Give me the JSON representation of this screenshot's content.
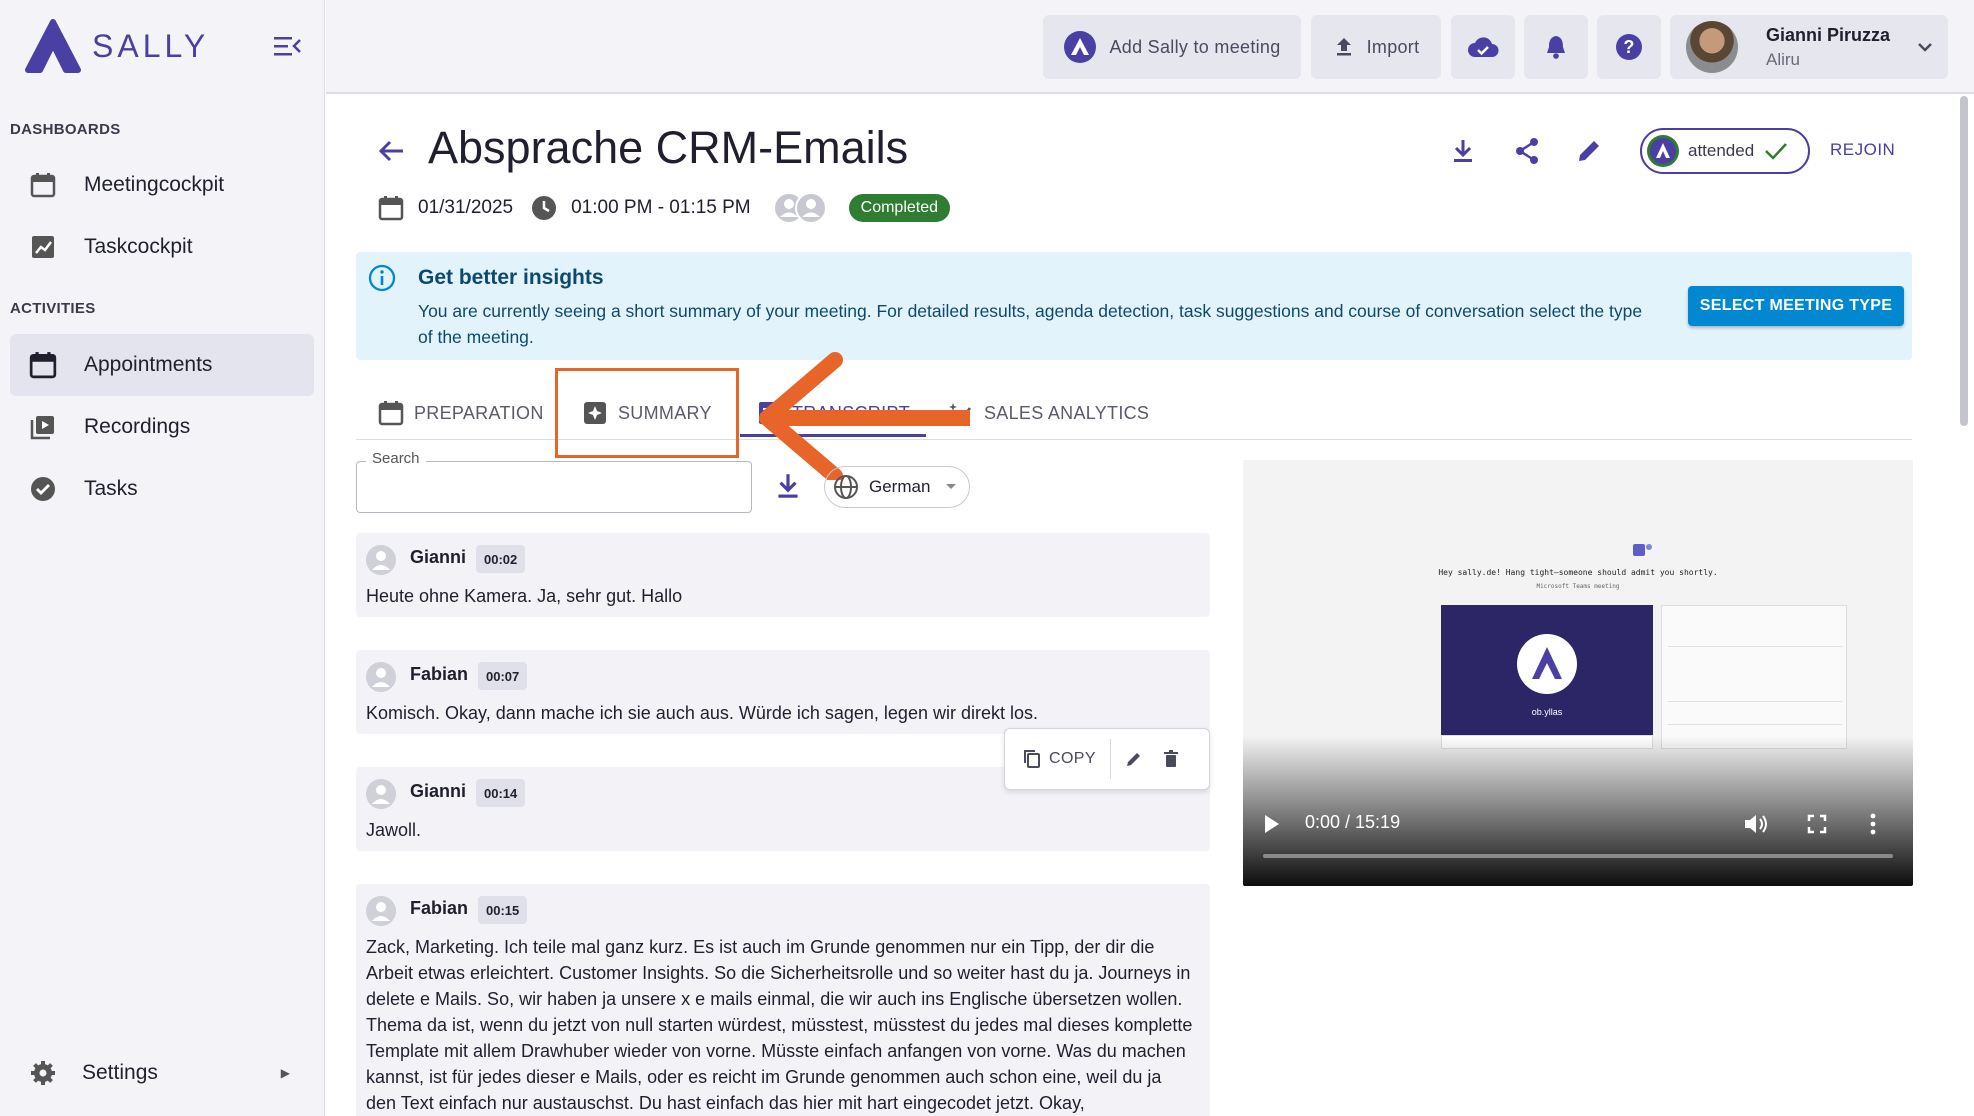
{
  "app": {
    "name": "SALLY"
  },
  "sidebar": {
    "sections": [
      {
        "label": "DASHBOARDS"
      },
      {
        "label": "ACTIVITIES"
      }
    ],
    "items": [
      {
        "label": "Meetingcockpit"
      },
      {
        "label": "Taskcockpit"
      },
      {
        "label": "Appointments"
      },
      {
        "label": "Recordings"
      },
      {
        "label": "Tasks"
      }
    ],
    "settings_label": "Settings"
  },
  "topbar": {
    "add_sally_label": "Add Sally to meeting",
    "import_label": "Import",
    "user": {
      "name": "Gianni Piruzza",
      "org": "Aliru"
    }
  },
  "meeting": {
    "title": "Absprache CRM-Emails",
    "date": "01/31/2025",
    "time": "01:00 PM - 01:15 PM",
    "status": "Completed",
    "attendance": "attended",
    "rejoin_label": "REJOIN"
  },
  "info": {
    "title": "Get better insights",
    "text": "You are currently seeing a short summary of your meeting. For detailed results, agenda detection, task suggestions and course of conversation select the type of the meeting.",
    "button": "SELECT MEETING TYPE"
  },
  "tabs": [
    {
      "label": "PREPARATION"
    },
    {
      "label": "SUMMARY"
    },
    {
      "label": "TRANSCRIPT"
    },
    {
      "label": "SALES ANALYTICS"
    }
  ],
  "transcript": {
    "search_label": "Search",
    "search_value": "",
    "language": "German",
    "copy_label": "COPY",
    "utterances": [
      {
        "speaker": "Gianni",
        "time": "00:02",
        "text": "Heute ohne Kamera. Ja, sehr gut. Hallo"
      },
      {
        "speaker": "Fabian",
        "time": "00:07",
        "text": "Komisch. Okay, dann mache ich sie auch aus. Würde ich sagen, legen wir direkt los."
      },
      {
        "speaker": "Gianni",
        "time": "00:14",
        "text": "Jawoll."
      },
      {
        "speaker": "Fabian",
        "time": "00:15",
        "text": "Zack, Marketing. Ich teile mal ganz kurz. Es ist auch im Grunde genommen nur ein Tipp, der dir die Arbeit etwas erleichtert. Customer Insights. So die Sicherheitsrolle und so weiter hast du ja. Journeys in delete e Mails. So, wir haben ja unsere x e mails einmal, die wir auch ins Englische übersetzen wollen. Thema da ist, wenn du jetzt von null starten würdest, müsstest, müsstest du jedes mal dieses komplette Template mit allem Drawhuber wieder von vorne. Müsste einfach anfangen von vorne. Was du machen kannst, ist für jedes dieser e Mails, oder es reicht im Grunde genommen auch schon eine, weil du ja den Text einfach nur austauschst. Du hast einfach das hier mit hart eingecodet jetzt. Okay,"
      }
    ]
  },
  "video": {
    "time_display": "0:00 / 15:19",
    "progress": 0,
    "preview_text": "Hey sally.de! Hang tight—someone should admit you shortly.",
    "preview_subtext": "Microsoft Teams meeting",
    "preview_name": "ob.yllas"
  },
  "colors": {
    "brand": "#4a3fa3",
    "accent_orange": "#e8652a",
    "info_bg": "#e3f3fb",
    "status_green": "#2e7d32",
    "primary_button": "#0288d1"
  }
}
